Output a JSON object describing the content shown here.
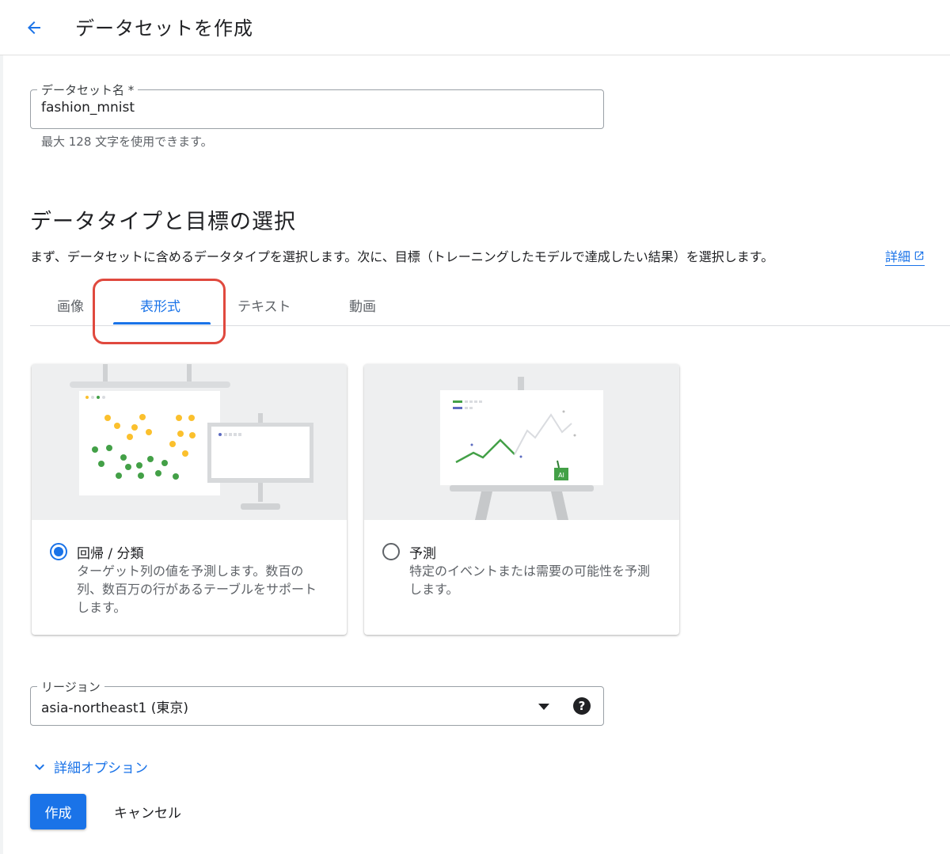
{
  "header": {
    "title": "データセットを作成"
  },
  "dataset_name": {
    "label": "データセット名 *",
    "value": "fashion_mnist",
    "hint": "最大 128 文字を使用できます。"
  },
  "section": {
    "title": "データタイプと目標の選択",
    "description": "まず、データセットに含めるデータタイプを選択します。次に、目標（トレーニングしたモデルで達成したい結果）を選択します。",
    "learn_more": "詳細"
  },
  "tabs": [
    {
      "label": "画像"
    },
    {
      "label": "表形式",
      "active": true
    },
    {
      "label": "テキスト"
    },
    {
      "label": "動画"
    }
  ],
  "cards": [
    {
      "title": "回帰 / 分類",
      "description": "ターゲット列の値を予測します。数百の列、数百万の行があるテーブルをサポートします。",
      "selected": true
    },
    {
      "title": "予測",
      "description": "特定のイベントまたは需要の可能性を予測します。",
      "selected": false
    }
  ],
  "region": {
    "label": "リージョン",
    "value": "asia-northeast1 (東京)"
  },
  "advanced_label": "詳細オプション",
  "actions": {
    "create": "作成",
    "cancel": "キャンセル"
  },
  "colors": {
    "primary": "#1a73e8",
    "annotation": "#e0493e",
    "green": "#43a047",
    "yellow": "#fbc02d"
  }
}
